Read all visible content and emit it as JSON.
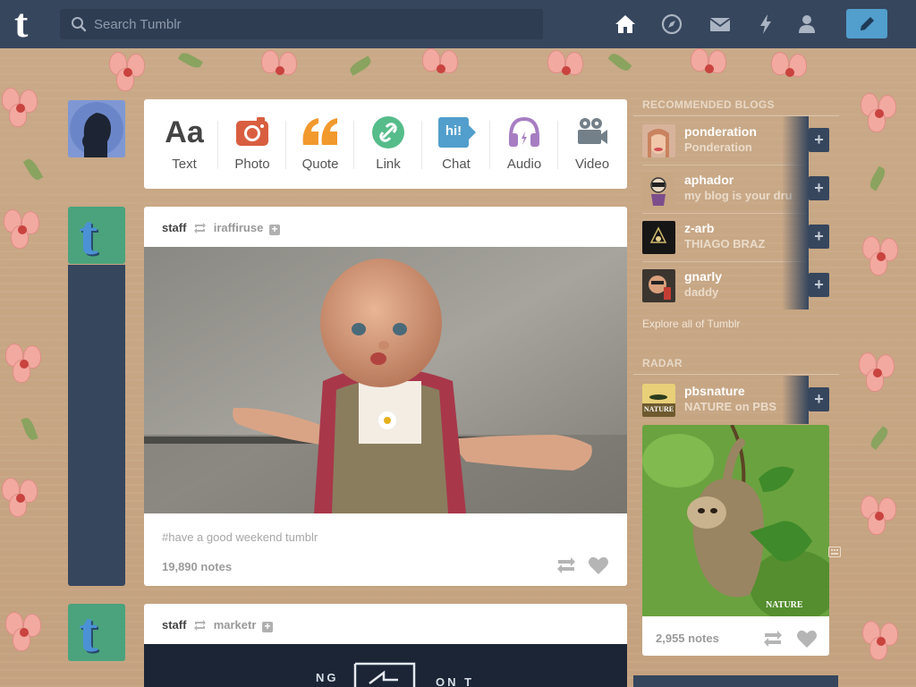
{
  "topbar": {
    "logo": "t",
    "search_placeholder": "Search Tumblr",
    "icons": [
      "home-icon",
      "compass-icon",
      "mail-icon",
      "lightning-icon",
      "account-icon",
      "pencil-icon"
    ]
  },
  "post_types": [
    {
      "label": "Text",
      "glyph": "Aa",
      "color": "#444444"
    },
    {
      "label": "Photo",
      "color": "#d95e40"
    },
    {
      "label": "Quote",
      "glyph": "66",
      "color": "#f2992e"
    },
    {
      "label": "Link",
      "color": "#56bc8a"
    },
    {
      "label": "Chat",
      "glyph": "hi!",
      "color": "#529ecc"
    },
    {
      "label": "Audio",
      "color": "#a77dc2"
    },
    {
      "label": "Video",
      "color": "#748089"
    }
  ],
  "posts": [
    {
      "blog": "staff",
      "source": "iraffiruse",
      "tags": "#have a good weekend tumblr",
      "notes": "19,890 notes"
    },
    {
      "blog": "staff",
      "source": "marketr",
      "banner_text_left": "NG",
      "banner_text_right": "ON T"
    }
  ],
  "sidebar": {
    "recommended_heading": "RECOMMENDED BLOGS",
    "recommended": [
      {
        "name": "ponderation",
        "title": "Ponderation"
      },
      {
        "name": "aphador",
        "title": "my blog is your dru"
      },
      {
        "name": "z-arb",
        "title": "THIAGO BRAZ"
      },
      {
        "name": "gnarly",
        "title": "daddy"
      }
    ],
    "follow_symbol": "+",
    "explore": "Explore all of Tumblr",
    "radar_heading": "RADAR",
    "radar": {
      "name": "pbsnature",
      "title": "NATURE on PBS",
      "avatar_text": "NATURE",
      "image_caption": "NATURE",
      "notes": "2,955 notes"
    }
  },
  "colors": {
    "nav": "#36465d",
    "accent": "#529ecc",
    "background": "#c8a785"
  }
}
